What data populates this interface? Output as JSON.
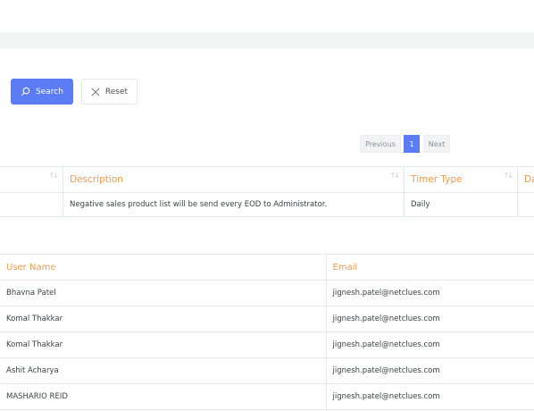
{
  "buttons": {
    "search_label": "Search",
    "reset_label": "Reset"
  },
  "pagination": {
    "previous": "Previous",
    "current": "1",
    "next": "Next"
  },
  "timer_table": {
    "headers": [
      "",
      "Description",
      "Timer Type",
      "Da"
    ],
    "rows": [
      {
        "description": "Negative sales product list will be send every EOD to Administrator.",
        "timer_type": "Daily"
      }
    ]
  },
  "user_table": {
    "headers": [
      "User Name",
      "Email"
    ],
    "rows": [
      {
        "name": "Bhavna Patel",
        "email": "jignesh.patel@netclues.com"
      },
      {
        "name": "Komal Thakkar",
        "email": "jignesh.patel@netclues.com"
      },
      {
        "name": "Komal Thakkar",
        "email": "jignesh.patel@netclues.com"
      },
      {
        "name": "Ashit Acharya",
        "email": "jignesh.patel@netclues.com"
      },
      {
        "name": "MASHARIO REID",
        "email": "jignesh.patel@netclues.com"
      }
    ]
  },
  "colors": {
    "accent": "#5b7cf5",
    "header_text": "#f39a4b",
    "band": "#f1f6f5"
  },
  "icons": {
    "search": "search-icon",
    "reset": "close-icon",
    "sort": "sort-icon"
  }
}
